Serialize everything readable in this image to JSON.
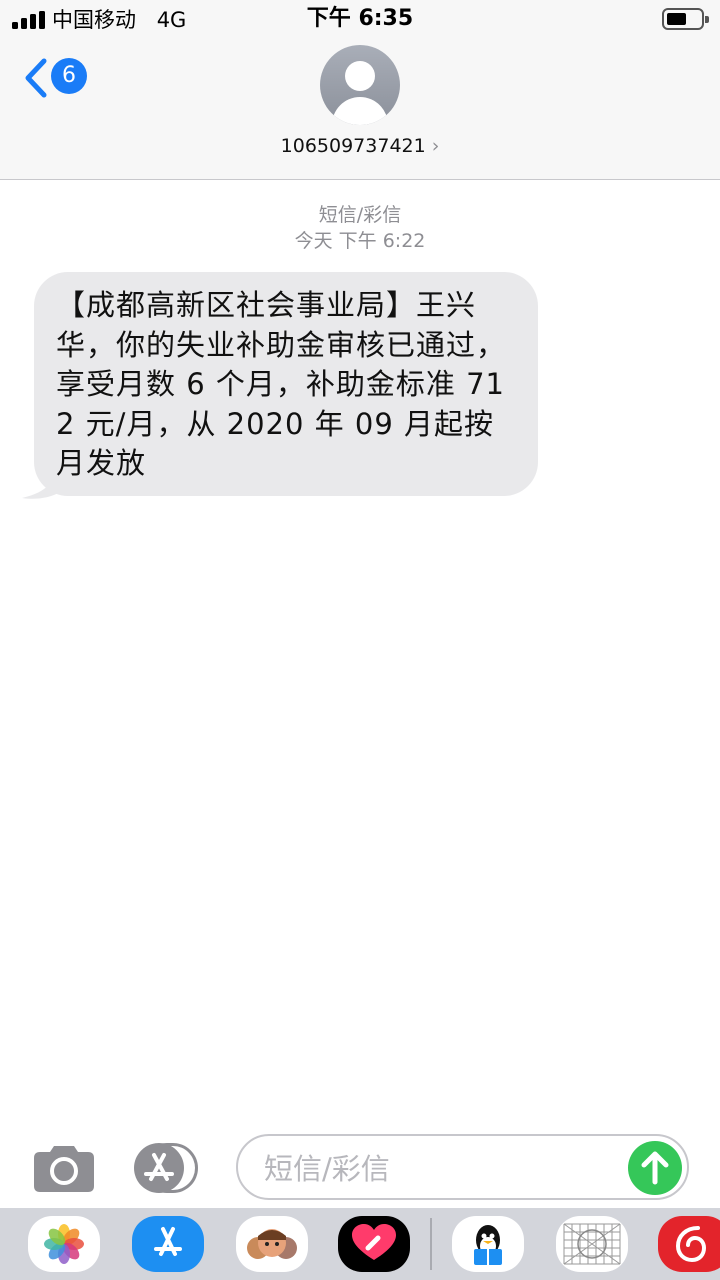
{
  "status_bar": {
    "carrier": "中国移动",
    "network": "4G",
    "time": "下午 6:35",
    "battery_level": 0.55
  },
  "nav": {
    "back_count": "6",
    "contact_number": "106509737421",
    "chevron": "›"
  },
  "thread": {
    "service_label": "短信/彩信",
    "timestamp": "今天 下午 6:22",
    "messages": [
      {
        "direction": "incoming",
        "text": "【成都高新区社会事业局】王兴华，你的失业补助金审核已通过，享受月数 6 个月，补助金标准 712 元/月，从 2020 年 09 月起按月发放"
      }
    ]
  },
  "composer": {
    "placeholder": "短信/彩信",
    "camera_icon": "camera-icon",
    "apps_icon": "app-store-icon",
    "send_icon": "arrow-up-icon"
  },
  "app_drawer": {
    "apps": [
      "photos-icon",
      "app-store-icon",
      "memoji-icon",
      "digital-touch-icon",
      "qq-icon",
      "grid-sticker-icon",
      "netease-music-icon"
    ]
  },
  "colors": {
    "accent_blue": "#1a7cf7",
    "send_green": "#35c759",
    "bubble_gray": "#e9e9eb",
    "meta_gray": "#8e8e93"
  }
}
